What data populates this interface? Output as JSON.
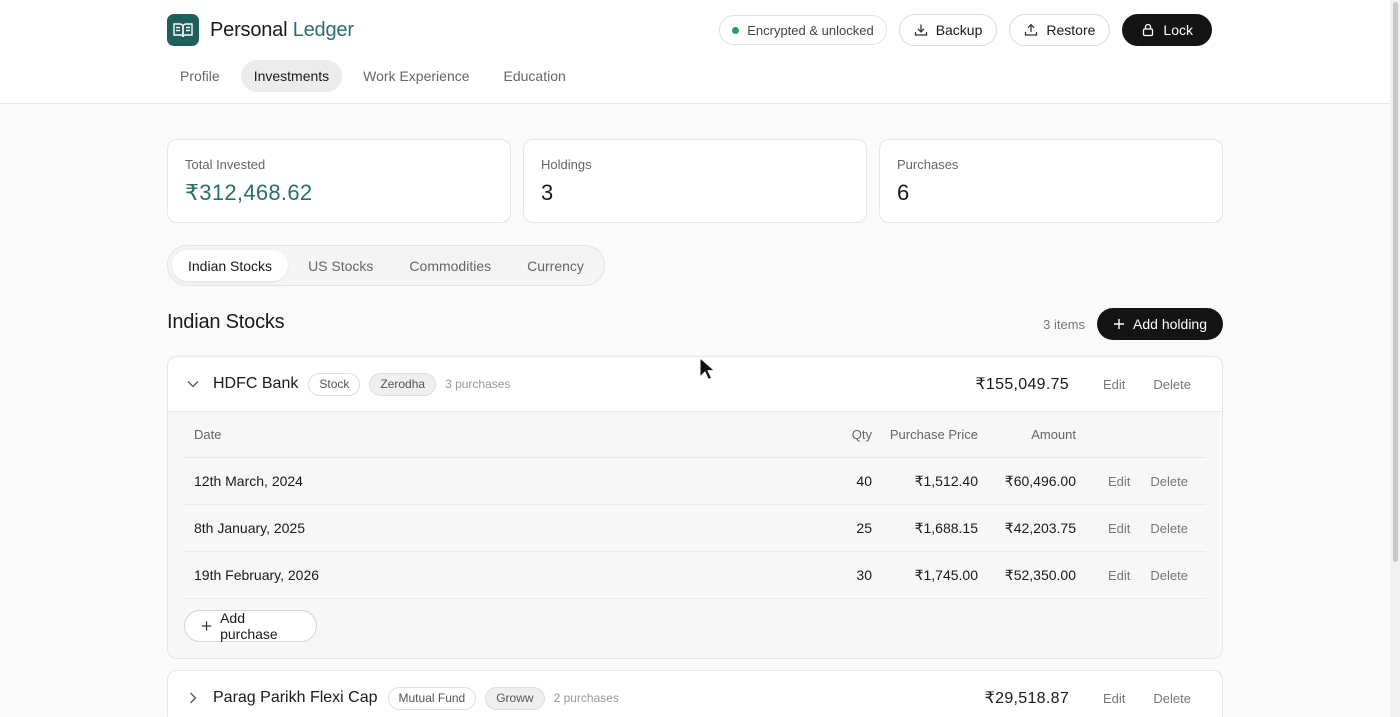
{
  "app": {
    "name_primary": "Personal",
    "name_accent": "Ledger",
    "status": "Encrypted & unlocked",
    "backup_label": "Backup",
    "restore_label": "Restore",
    "lock_label": "Lock",
    "colors": {
      "accent": "#2a6f6a",
      "status": "#22a05b",
      "dark": "#141414"
    }
  },
  "nav": {
    "items": [
      "Profile",
      "Investments",
      "Work Experience",
      "Education"
    ],
    "active": "Investments"
  },
  "stats": [
    {
      "label": "Total Invested",
      "value": "₹312,468.62"
    },
    {
      "label": "Holdings",
      "value": "3"
    },
    {
      "label": "Purchases",
      "value": "6"
    }
  ],
  "tabs": {
    "items": [
      "Indian Stocks",
      "US Stocks",
      "Commodities",
      "Currency"
    ],
    "active": "Indian Stocks"
  },
  "section": {
    "title": "Indian Stocks",
    "count": "3 items",
    "add_label": "Add holding"
  },
  "table_headers": {
    "date": "Date",
    "qty": "Qty",
    "price": "Purchase Price",
    "amount": "Amount"
  },
  "holdings": [
    {
      "name": "HDFC Bank",
      "type": "Stock",
      "broker": "Zerodha",
      "purchases_label": "3 purchases",
      "amount": "₹155,049.75",
      "edit": "Edit",
      "delete": "Delete",
      "expanded": true,
      "rows": [
        {
          "date": "12th March, 2024",
          "qty": "40",
          "price": "₹1,512.40",
          "amount": "₹60,496.00",
          "edit": "Edit",
          "delete": "Delete"
        },
        {
          "date": "8th January, 2025",
          "qty": "25",
          "price": "₹1,688.15",
          "amount": "₹42,203.75",
          "edit": "Edit",
          "delete": "Delete"
        },
        {
          "date": "19th February, 2026",
          "qty": "30",
          "price": "₹1,745.00",
          "amount": "₹52,350.00",
          "edit": "Edit",
          "delete": "Delete"
        }
      ],
      "add_purchase_label": "Add purchase"
    },
    {
      "name": "Parag Parikh Flexi Cap",
      "type": "Mutual Fund",
      "broker": "Groww",
      "purchases_label": "2 purchases",
      "amount": "₹29,518.87",
      "edit": "Edit",
      "delete": "Delete",
      "expanded": false
    }
  ]
}
